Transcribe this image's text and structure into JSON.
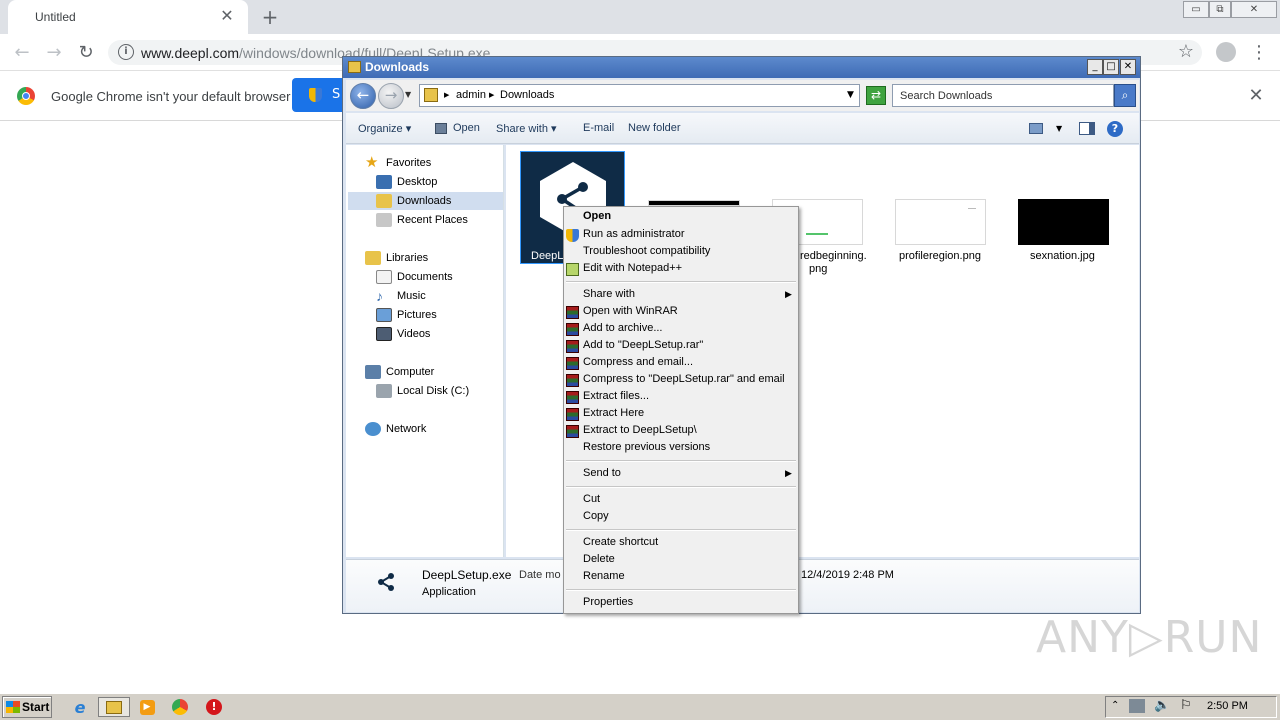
{
  "chrome": {
    "tab_title": "Untitled",
    "tab_close": "✕",
    "new_tab": "+",
    "url_host": "www.deepl.com",
    "url_path": "/windows/download/full/DeepLSetup.exe",
    "infobar_text": "Google Chrome isn't your default browser",
    "infobar_button": "S",
    "infobar_close": "✕"
  },
  "explorer": {
    "title": "Downloads",
    "breadcrumb": [
      "admin",
      "Downloads"
    ],
    "search_placeholder": "Search Downloads",
    "commands": {
      "organize": "Organize",
      "open": "Open",
      "share_with": "Share with",
      "email": "E-mail",
      "new_folder": "New folder"
    },
    "nav": {
      "favorites": "Favorites",
      "desktop": "Desktop",
      "downloads": "Downloads",
      "recent": "Recent Places",
      "libraries": "Libraries",
      "documents": "Documents",
      "music": "Music",
      "pictures": "Pictures",
      "videos": "Videos",
      "computer": "Computer",
      "local_disk": "Local Disk (C:)",
      "network": "Network"
    },
    "files": {
      "deepl": "DeepL",
      "redbeginning_1": "redbeginning.",
      "redbeginning_2": "png",
      "profileregion": "profileregion.png",
      "sexnation": "sexnation.jpg"
    },
    "details": {
      "name": "DeepLSetup.exe",
      "date_label": "Date mo",
      "type": "Application",
      "date": "12/4/2019 2:48 PM"
    }
  },
  "context_menu": {
    "open": "Open",
    "run_as_admin": "Run as administrator",
    "troubleshoot": "Troubleshoot compatibility",
    "edit_notepad": "Edit with Notepad++",
    "share_with": "Share with",
    "open_winrar": "Open with WinRAR",
    "add_archive": "Add to archive...",
    "add_rar": "Add to \"DeepLSetup.rar\"",
    "compress_email": "Compress and email...",
    "compress_rar_email": "Compress to \"DeepLSetup.rar\" and email",
    "extract_files": "Extract files...",
    "extract_here": "Extract Here",
    "extract_to": "Extract to DeepLSetup\\",
    "restore": "Restore previous versions",
    "send_to": "Send to",
    "cut": "Cut",
    "copy": "Copy",
    "create_shortcut": "Create shortcut",
    "delete": "Delete",
    "rename": "Rename",
    "properties": "Properties"
  },
  "watermark": "ANY▷RUN",
  "taskbar": {
    "start": "Start",
    "clock": "2:50 PM"
  },
  "colors": {
    "chrome_frame": "#dee1e6",
    "explorer_title": "#3e6bb5",
    "deepl_tile": "#0f2b46",
    "selection": "#d0ddef"
  }
}
